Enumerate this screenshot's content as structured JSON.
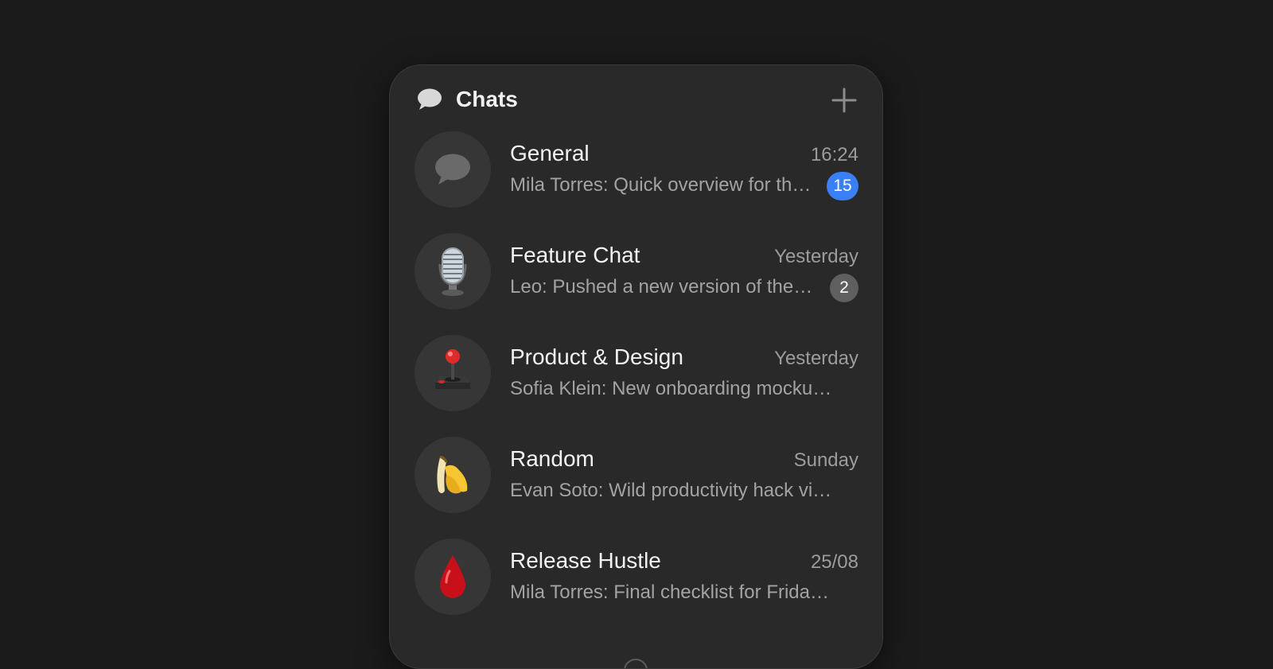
{
  "header": {
    "title": "Chats",
    "icon": "chat-bubble-icon",
    "add_icon": "plus-icon"
  },
  "colors": {
    "background": "#1b1b1b",
    "panel": "#292929",
    "accent_badge": "#3b7ff4",
    "muted_badge": "#5f5f5f"
  },
  "chats": [
    {
      "name": "General",
      "time": "16:24",
      "preview": "Mila Torres: Quick overview for the team on the upcoming sprint",
      "unread": "15",
      "badge_style": "accent",
      "avatar_icon": "chat-bubble-icon"
    },
    {
      "name": "Feature Chat",
      "time": "Yesterday",
      "preview": "Leo: Pushed a new version of the feature branch",
      "unread": "2",
      "badge_style": "muted",
      "avatar_icon": "microphone-icon"
    },
    {
      "name": "Product & Design",
      "time": "Yesterday",
      "preview": "Sofia Klein: New onboarding mockups are ready",
      "avatar_icon": "joystick-icon"
    },
    {
      "name": "Random",
      "time": "Sunday",
      "preview": "Evan Soto: Wild productivity hack video",
      "avatar_icon": "banana-icon"
    },
    {
      "name": "Release Hustle",
      "time": "25/08",
      "preview": "Mila Torres: Final checklist for Friday’s release",
      "avatar_icon": "drop-of-blood-icon"
    }
  ]
}
